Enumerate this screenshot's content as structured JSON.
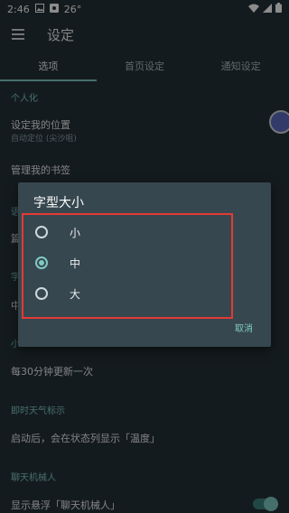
{
  "status_bar": {
    "time": "2:46",
    "temperature": "26°"
  },
  "app_bar": {
    "title": "设定"
  },
  "tabs": [
    {
      "label": "选项",
      "active": true
    },
    {
      "label": "首页设定",
      "active": false
    },
    {
      "label": "通知设定",
      "active": false
    }
  ],
  "settings": {
    "section_personal": "个人化",
    "set_location_title": "设定我的位置",
    "set_location_summary": "自动定位 (尖沙咀)",
    "bookmarks_title": "管理我的书签",
    "hidden_section_2": "语",
    "hidden_item_2": "篇",
    "hidden_section_3": "字",
    "hidden_item_3": "中",
    "hidden_section_4": "小",
    "update_interval": "每30分钟更新一次",
    "section_weather": "即时天气标示",
    "weather_summary": "启动后，会在状态列显示「温度」",
    "section_chatbot": "聊天机械人",
    "chatbot_title": "显示悬浮「聊天机械人」"
  },
  "dialog": {
    "title": "字型大小",
    "options": [
      {
        "label": "小",
        "checked": false
      },
      {
        "label": "中",
        "checked": true
      },
      {
        "label": "大",
        "checked": false
      }
    ],
    "cancel_label": "取消"
  },
  "colors": {
    "accent": "#80cbc4",
    "background": "#263238",
    "dialog": "#37474f",
    "highlight_box": "#e53935"
  }
}
